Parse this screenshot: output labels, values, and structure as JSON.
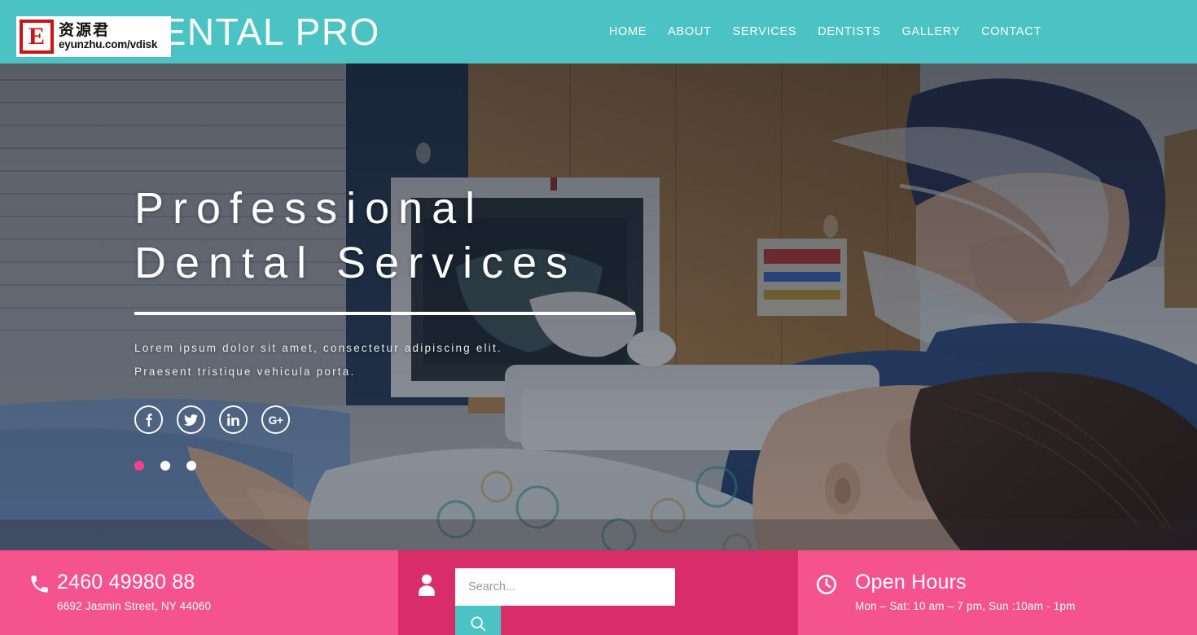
{
  "header": {
    "brand": "DENTAL PRO",
    "brand_color": "#ffffff",
    "background_color": "#4bc2c4",
    "nav": [
      {
        "label": "HOME",
        "name": "nav-home"
      },
      {
        "label": "ABOUT",
        "name": "nav-about"
      },
      {
        "label": "SERVICES",
        "name": "nav-services"
      },
      {
        "label": "DENTISTS",
        "name": "nav-dentists"
      },
      {
        "label": "GALLERY",
        "name": "nav-gallery"
      },
      {
        "label": "CONTACT",
        "name": "nav-contact"
      }
    ]
  },
  "watermark": {
    "logo_letter": "E",
    "chinese_text": "资源君",
    "url": "eyunzhu.com/vdisk",
    "logo_color": "#cc1417"
  },
  "hero": {
    "title_line1": "Professional",
    "title_line2": "Dental Services",
    "subtitle_line1": "Lorem ipsum dolor sit amet, consectetur adipiscing elit.",
    "subtitle_line2": "Praesent tristique vehicula porta.",
    "socials": [
      {
        "icon": "facebook-icon",
        "glyph": "f"
      },
      {
        "icon": "twitter-icon",
        "glyph": "twitter"
      },
      {
        "icon": "linkedin-icon",
        "glyph": "in"
      },
      {
        "icon": "google-plus-icon",
        "glyph": "G+"
      }
    ],
    "carousel": {
      "total": 3,
      "active_index": 0,
      "active_color": "#f7408a",
      "inactive_color": "#ffffff"
    }
  },
  "bottom_bar": {
    "contact": {
      "icon": "phone-icon",
      "phone": "2460 49980 88",
      "address": "6692 Jasmin Street, NY 44060",
      "background_color": "#f4538c"
    },
    "search": {
      "icon": "person-icon",
      "placeholder": "Search...",
      "value": "",
      "button_icon": "magnifier-icon",
      "button_color": "#4bc2c4",
      "background_color": "#d82d68"
    },
    "hours": {
      "icon": "clock-icon",
      "title": "Open Hours",
      "detail": "Mon – Sat: 10 am – 7 pm, Sun :10am - 1pm",
      "background_color": "#f4538c"
    }
  }
}
